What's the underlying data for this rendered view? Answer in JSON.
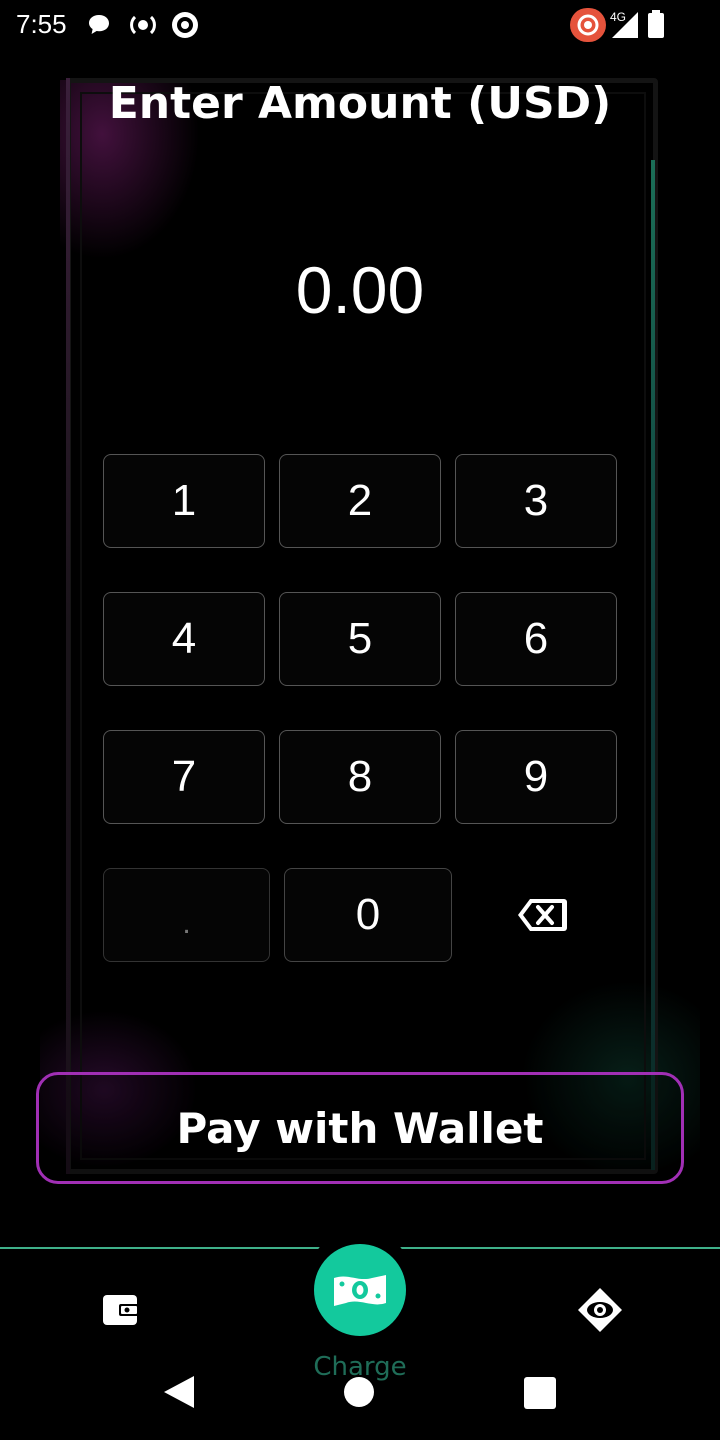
{
  "status_bar": {
    "time": "7:55",
    "left_icons": [
      "chat-bubble-icon",
      "radio-target-icon",
      "circle-target-icon"
    ],
    "right_icons": [
      "record-badge-icon",
      "signal-4g-icon",
      "battery-icon"
    ],
    "network": "4G"
  },
  "screen": {
    "title": "Enter Amount (USD)",
    "amount": "0.00"
  },
  "keypad": {
    "keys": [
      "1",
      "2",
      "3",
      "4",
      "5",
      "6",
      "7",
      "8",
      "9",
      ".",
      "0"
    ],
    "backspace_icon": "backspace-icon"
  },
  "pay_button": {
    "label": "Pay with Wallet"
  },
  "bottom_nav": {
    "wallet_icon": "wallet-icon",
    "charge_icon": "cash-icon",
    "charge_label": "Charge",
    "scan_icon": "scan-eye-icon"
  },
  "colors": {
    "accent_green": "#13c99d",
    "button_border": "#a12fb5",
    "nav_line": "#3fb08a"
  }
}
